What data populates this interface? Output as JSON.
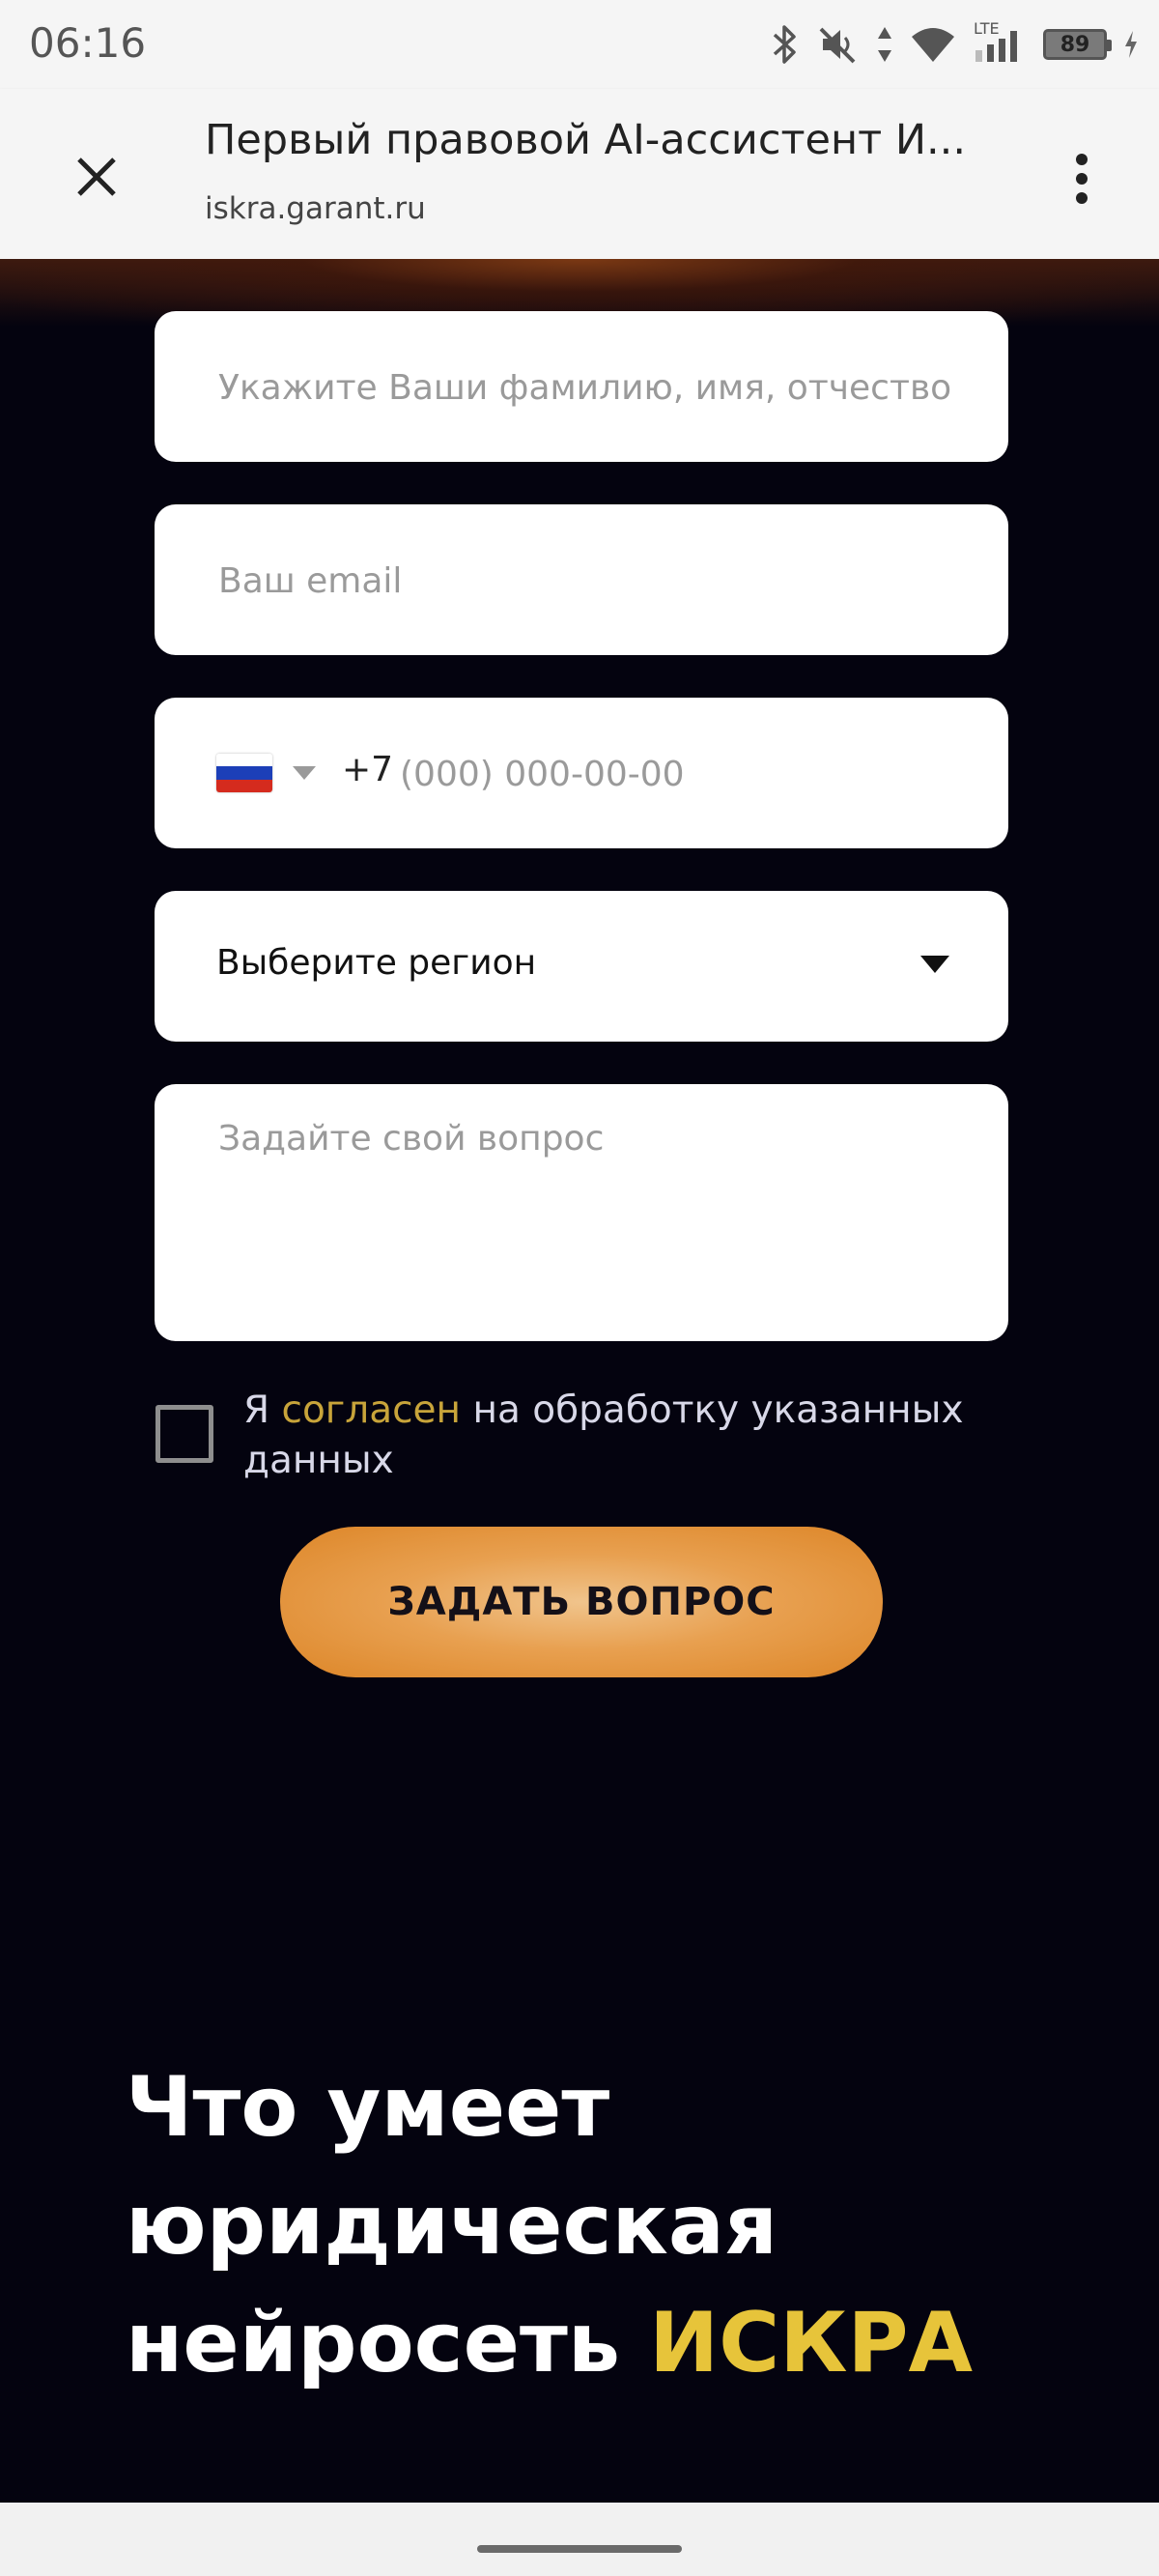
{
  "status_bar": {
    "time": "06:16",
    "network_label": "LTE",
    "battery_level": "89",
    "icons": [
      "bluetooth-icon",
      "mute-icon",
      "data-arrows-icon",
      "wifi-icon",
      "signal-icon",
      "battery-icon",
      "charging-icon"
    ]
  },
  "browser": {
    "title": "Первый правовой AI-ассистент И...",
    "url": "iskra.garant.ru",
    "icons": [
      "close-icon",
      "more-vert-icon"
    ]
  },
  "form": {
    "name_placeholder": "Укажите Ваши фамилию, имя, отчество",
    "email_placeholder": "Ваш email",
    "phone": {
      "country_icon": "russia-flag-icon",
      "prefix": "+7",
      "placeholder": "(000) 000-00-00"
    },
    "region_label": "Выберите регион",
    "question_placeholder": "Задайте свой вопрос",
    "consent": {
      "before": "Я ",
      "link": "согласен",
      "after": " на обработку указанных данных"
    },
    "submit_label": "ЗАДАТЬ ВОПРОС"
  },
  "section": {
    "heading_line1": "Что умеет",
    "heading_line2": "юридическая",
    "heading_line3": "нейросеть ",
    "heading_accent": "ИСКРА"
  },
  "colors": {
    "background": "#04030f",
    "accent_gold": "#e7c43a",
    "link_gold": "#c8a43a",
    "button_orange": "#dd8628"
  }
}
